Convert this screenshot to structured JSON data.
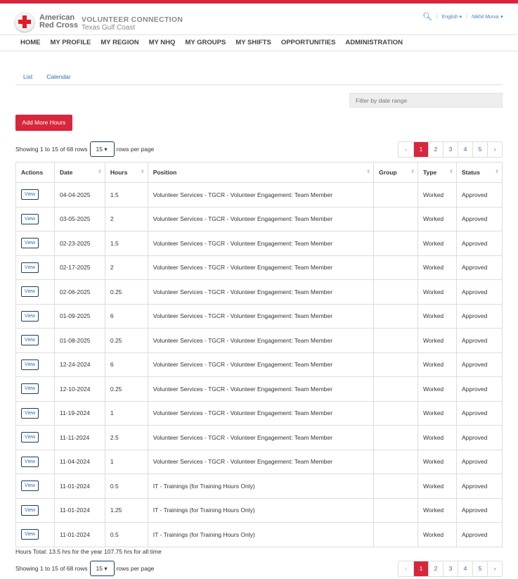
{
  "header": {
    "brand_line1": "American",
    "brand_line2": "Red Cross",
    "app_name": "VOLUNTEER CONNECTION",
    "region": "Texas Gulf Coast",
    "language": "English",
    "user": "Nikhil Murva"
  },
  "nav": [
    "HOME",
    "MY PROFILE",
    "MY REGION",
    "MY NHQ",
    "MY GROUPS",
    "MY SHIFTS",
    "OPPORTUNITIES",
    "ADMINISTRATION"
  ],
  "tabs": [
    "List",
    "Calendar"
  ],
  "filter_placeholder": "Filter by date range",
  "add_button": "Add More Hours",
  "showing": "Showing 1 to 15 of 68 rows",
  "page_size": "15",
  "rows_per_page": "rows per page",
  "pager": [
    "‹",
    "1",
    "2",
    "3",
    "4",
    "5",
    "›"
  ],
  "columns": [
    "Actions",
    "Date",
    "Hours",
    "Position",
    "Group",
    "Type",
    "Status"
  ],
  "view_label": "View",
  "rows": [
    [
      "04-04-2025",
      "1.5",
      "Volunteer Services - TGCR - Volunteer Engagement: Team Member",
      "",
      "Worked",
      "Approved"
    ],
    [
      "03-05-2025",
      "2",
      "Volunteer Services - TGCR - Volunteer Engagement: Team Member",
      "",
      "Worked",
      "Approved"
    ],
    [
      "02-23-2025",
      "1.5",
      "Volunteer Services - TGCR - Volunteer Engagement: Team Member",
      "",
      "Worked",
      "Approved"
    ],
    [
      "02-17-2025",
      "2",
      "Volunteer Services - TGCR - Volunteer Engagement: Team Member",
      "",
      "Worked",
      "Approved"
    ],
    [
      "02-06-2025",
      "0.25",
      "Volunteer Services - TGCR - Volunteer Engagement: Team Member",
      "",
      "Worked",
      "Approved"
    ],
    [
      "01-09-2025",
      "6",
      "Volunteer Services - TGCR - Volunteer Engagement: Team Member",
      "",
      "Worked",
      "Approved"
    ],
    [
      "01-08-2025",
      "0.25",
      "Volunteer Services - TGCR - Volunteer Engagement: Team Member",
      "",
      "Worked",
      "Approved"
    ],
    [
      "12-24-2024",
      "6",
      "Volunteer Services - TGCR - Volunteer Engagement: Team Member",
      "",
      "Worked",
      "Approved"
    ],
    [
      "12-10-2024",
      "0.25",
      "Volunteer Services - TGCR - Volunteer Engagement: Team Member",
      "",
      "Worked",
      "Approved"
    ],
    [
      "11-19-2024",
      "1",
      "Volunteer Services - TGCR - Volunteer Engagement: Team Member",
      "",
      "Worked",
      "Approved"
    ],
    [
      "11-11-2024",
      "2.5",
      "Volunteer Services - TGCR - Volunteer Engagement: Team Member",
      "",
      "Worked",
      "Approved"
    ],
    [
      "11-04-2024",
      "1",
      "Volunteer Services - TGCR - Volunteer Engagement: Team Member",
      "",
      "Worked",
      "Approved"
    ],
    [
      "11-01-2024",
      "0.5",
      "IT - Trainings (for Training Hours Only)",
      "",
      "Worked",
      "Approved"
    ],
    [
      "11-01-2024",
      "1.25",
      "IT - Trainings (for Training Hours Only)",
      "",
      "Worked",
      "Approved"
    ],
    [
      "11-01-2024",
      "0.5",
      "IT - Trainings (for Training Hours Only)",
      "",
      "Worked",
      "Approved"
    ]
  ],
  "hours_total": "Hours Total: 13.5 hrs for the year 107.75 hrs for all time"
}
